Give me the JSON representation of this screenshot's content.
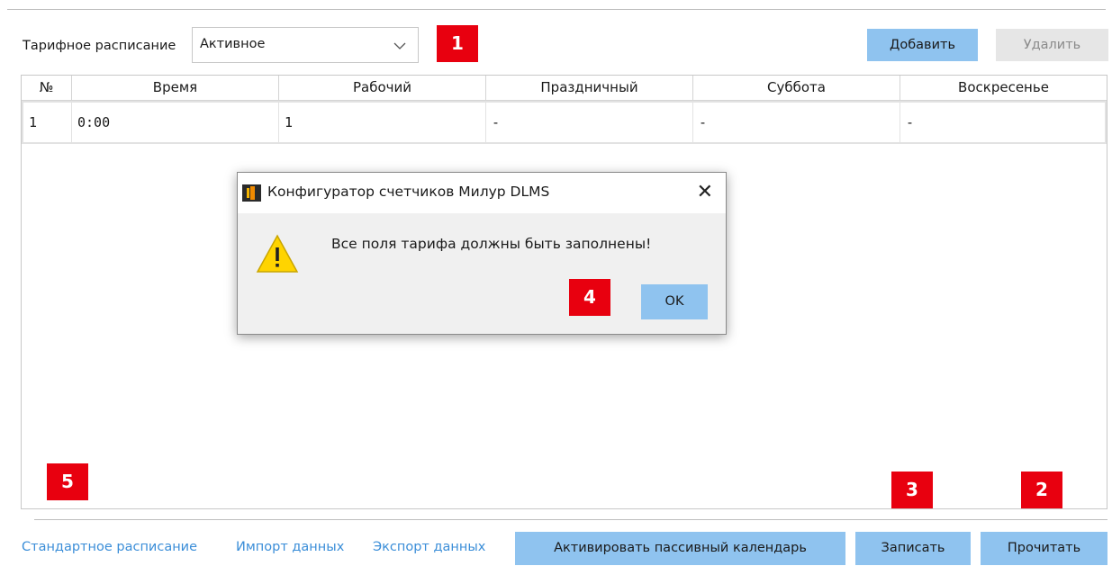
{
  "toolbar": {
    "schedule_label": "Тарифное расписание",
    "schedule_value": "Активное",
    "add_label": "Добавить",
    "delete_label": "Удалить"
  },
  "table": {
    "columns": [
      "№",
      "Время",
      "Рабочий",
      "Праздничный",
      "Суббота",
      "Воскресенье"
    ],
    "rows": [
      [
        "1",
        "0:00",
        "1",
        "-",
        "-",
        "-"
      ]
    ]
  },
  "footer": {
    "link_standard": "Стандартное расписание",
    "link_import": "Импорт данных",
    "link_export": "Экспорт данных",
    "activate_label": "Активировать пассивный календарь",
    "write_label": "Записать",
    "read_label": "Прочитать"
  },
  "dialog": {
    "title": "Конфигуратор счетчиков Милур DLMS",
    "message": "Все поля тарифа должны быть заполнены!",
    "ok_label": "OK",
    "close_glyph": "✕"
  },
  "badges": {
    "b1": "1",
    "b2": "2",
    "b3": "3",
    "b4": "4",
    "b5": "5"
  },
  "colors": {
    "accent_button": "#8fc3ef",
    "badge_red": "#e8000f",
    "link_blue": "#3b8ed8",
    "warning_yellow": "#ffd400"
  },
  "icons": {
    "dropdown": "chevron-down-icon",
    "warning": "warning-icon",
    "app": "app-logo-icon",
    "close": "close-icon"
  }
}
